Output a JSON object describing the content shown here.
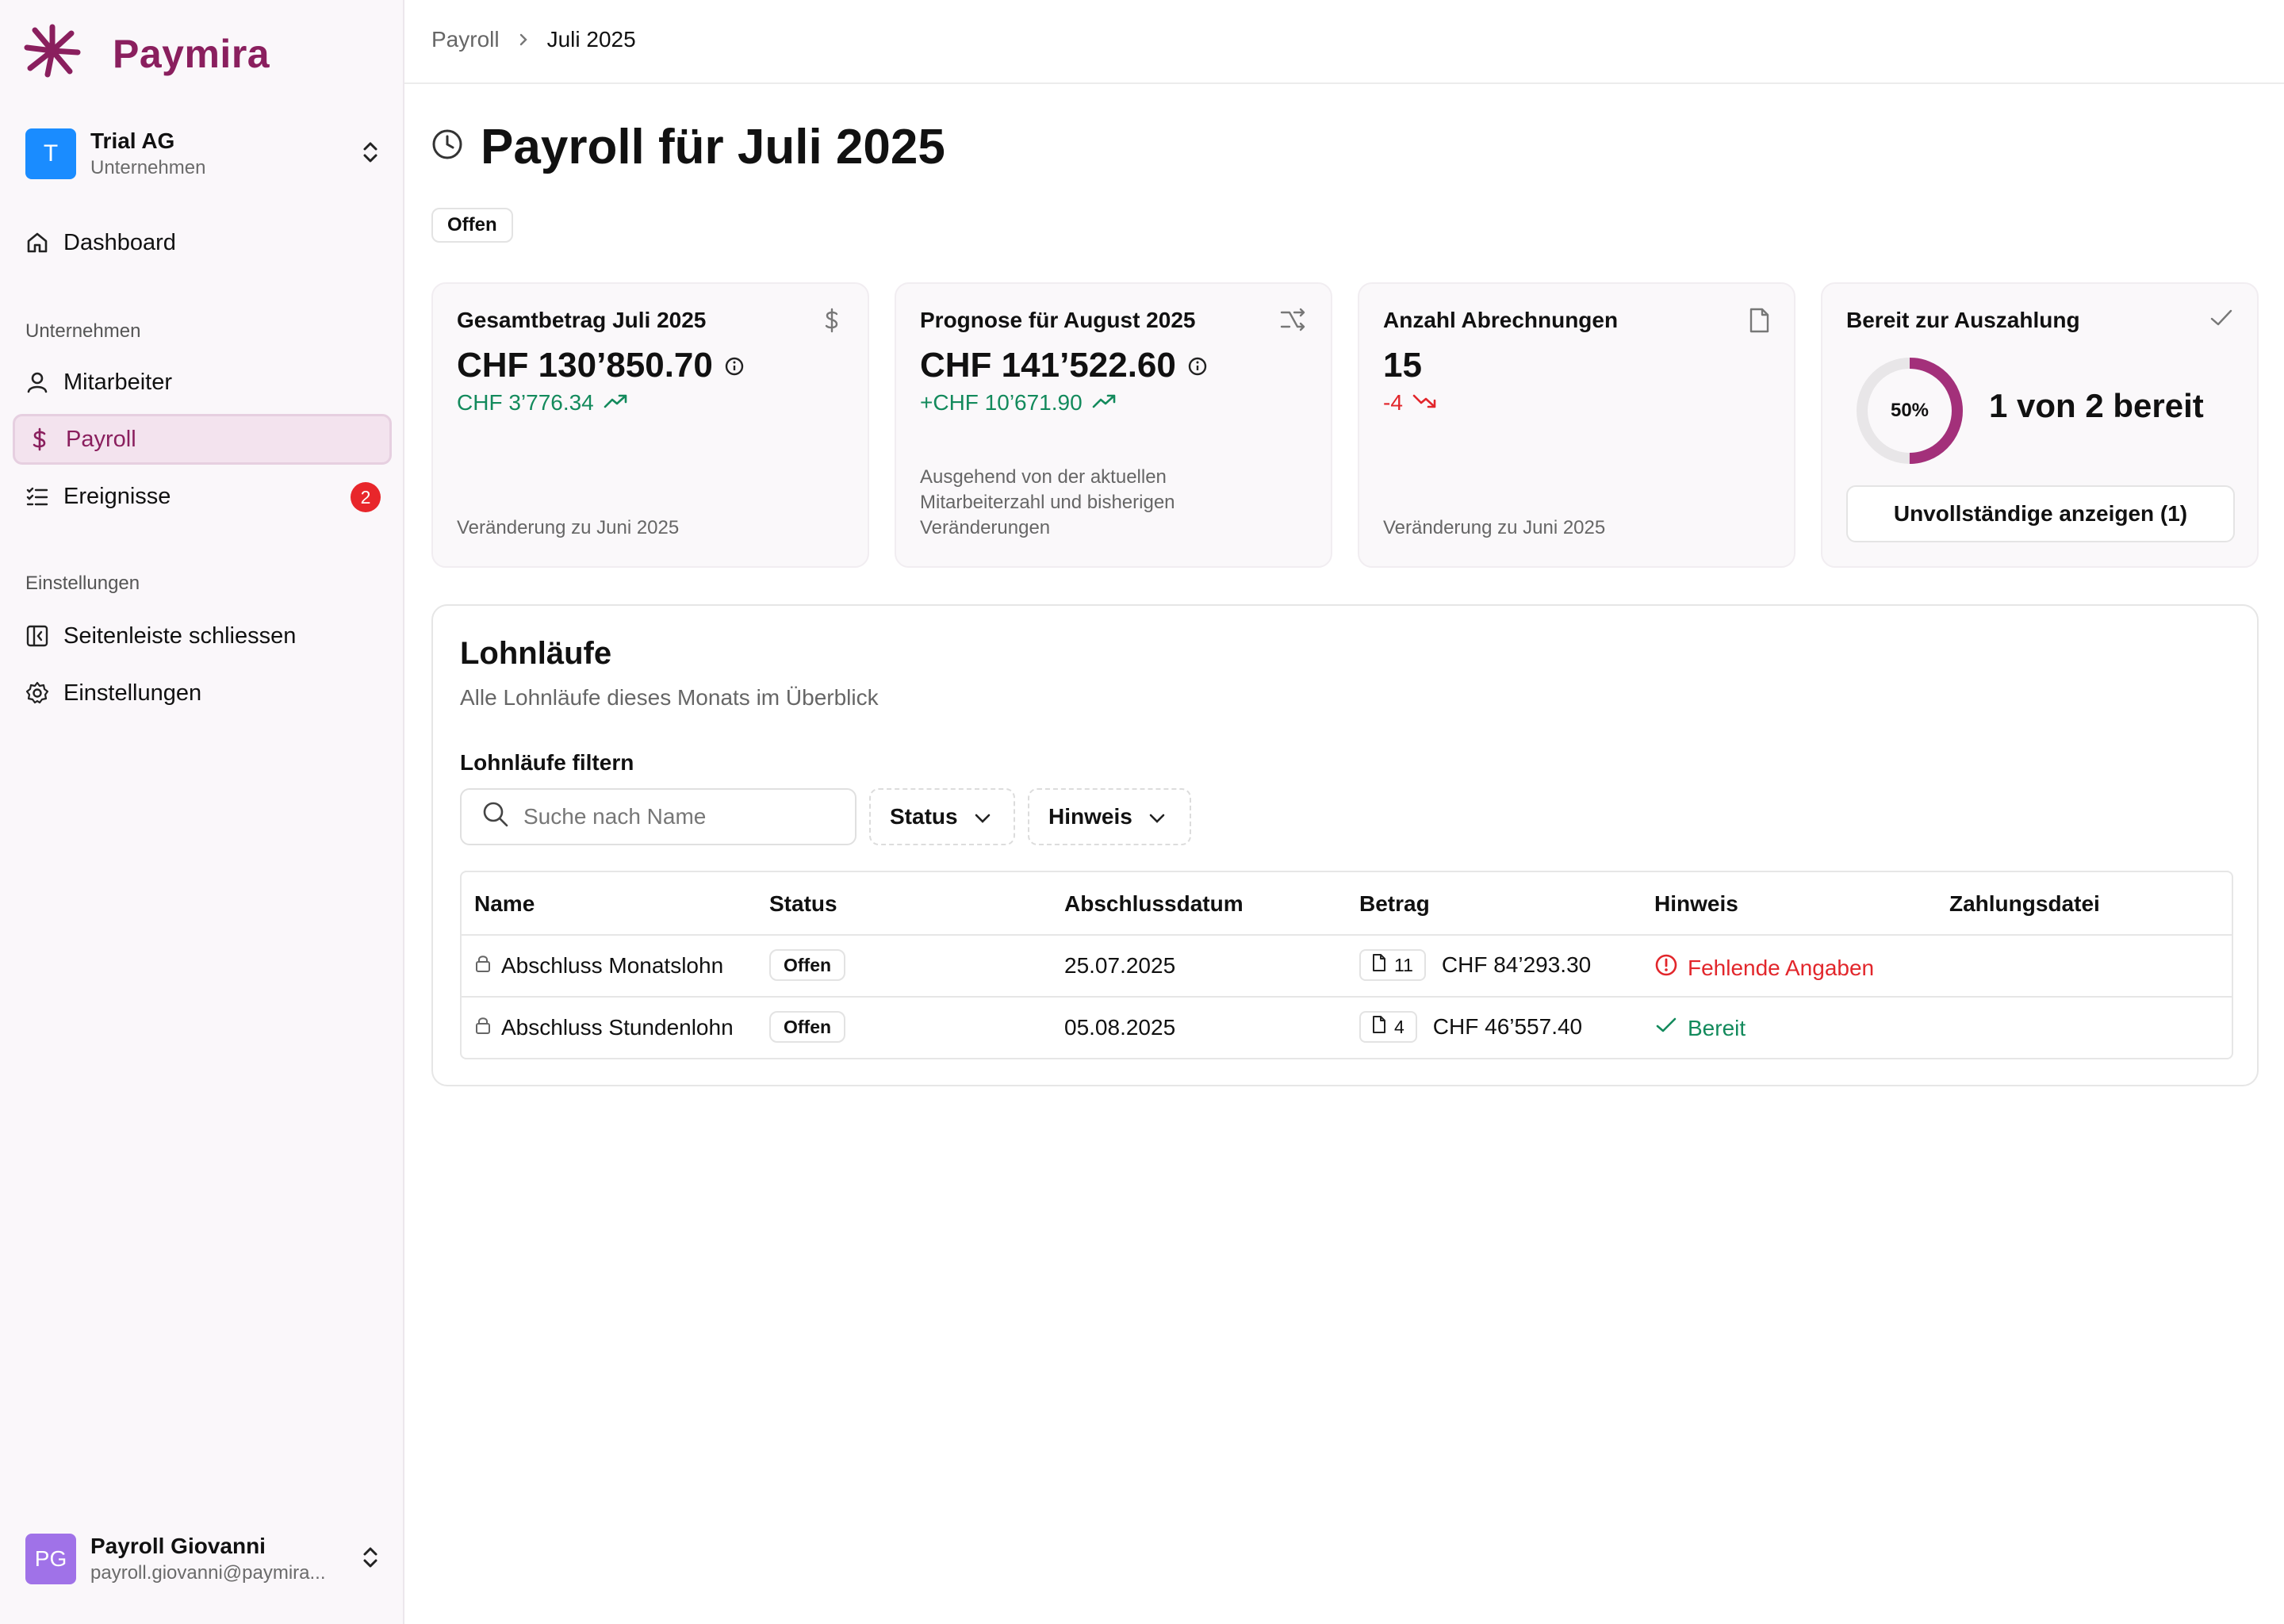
{
  "brand": {
    "name": "Paymira",
    "color": "#8a1f5e"
  },
  "company": {
    "initial": "T",
    "name": "Trial AG",
    "type": "Unternehmen"
  },
  "nav": {
    "dashboard": "Dashboard",
    "section_company": "Unternehmen",
    "employees": "Mitarbeiter",
    "payroll": "Payroll",
    "events": "Ereignisse",
    "events_badge": "2",
    "section_settings": "Einstellungen",
    "close_sidebar": "Seitenleiste schliessen",
    "settings": "Einstellungen"
  },
  "user": {
    "initials": "PG",
    "name": "Payroll Giovanni",
    "email": "payroll.giovanni@paymira..."
  },
  "breadcrumb": {
    "parent": "Payroll",
    "current": "Juli 2025"
  },
  "page": {
    "title": "Payroll für Juli 2025",
    "status": "Offen"
  },
  "cards": {
    "total": {
      "title": "Gesamtbetrag Juli 2025",
      "value": "CHF 130’850.70",
      "delta": "CHF 3’776.34",
      "footer": "Veränderung zu Juni 2025",
      "icon": "dollar-icon"
    },
    "forecast": {
      "title": "Prognose für August 2025",
      "value": "CHF 141’522.60",
      "delta": "+CHF 10’671.90",
      "footer": "Ausgehend von der aktuellen Mitarbeiterzahl und bisherigen Veränderungen",
      "icon": "shuffle-trend-icon"
    },
    "count": {
      "title": "Anzahl Abrechnungen",
      "value": "15",
      "delta": "-4",
      "footer": "Veränderung zu Juni 2025",
      "icon": "document-icon"
    },
    "ready": {
      "title": "Bereit zur Auszahlung",
      "percent_label": "50%",
      "percent": 50,
      "summary": "1 von 2 bereit",
      "button": "Unvollständige anzeigen (1)",
      "icon": "check-icon"
    }
  },
  "runs": {
    "title": "Lohnläufe",
    "subtitle": "Alle Lohnläufe dieses Monats im Überblick",
    "filter_label": "Lohnläufe filtern",
    "search_placeholder": "Suche nach Name",
    "status_filter": "Status",
    "hint_filter": "Hinweis",
    "columns": [
      "Name",
      "Status",
      "Abschlussdatum",
      "Betrag",
      "Hinweis",
      "Zahlungsdatei"
    ],
    "rows": [
      {
        "name": "Abschluss Monatslohn",
        "status": "Offen",
        "date": "25.07.2025",
        "count": "11",
        "amount": "CHF 84’293.30",
        "hint": "Fehlende Angaben",
        "hint_type": "error"
      },
      {
        "name": "Abschluss Stundenlohn",
        "status": "Offen",
        "date": "05.08.2025",
        "count": "4",
        "amount": "CHF 46’557.40",
        "hint": "Bereit",
        "hint_type": "ok"
      }
    ]
  },
  "colors": {
    "accent": "#8a1f5e",
    "positive": "#138a5c",
    "negative": "#e2262b",
    "company_avatar": "#1a8cff",
    "user_avatar": "#a072e8",
    "donut": "#a3307a"
  }
}
